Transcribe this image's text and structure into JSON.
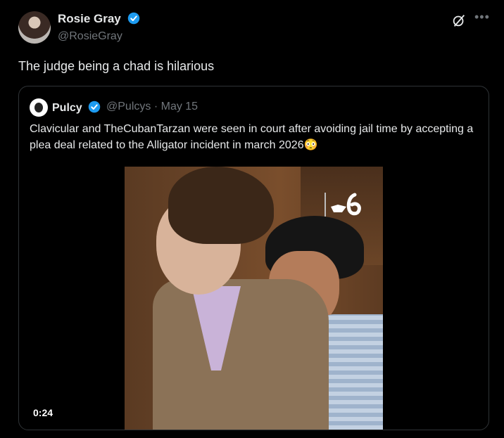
{
  "tweet": {
    "author_name": "Rosie Gray",
    "author_handle": "@RosieGray",
    "text": "The judge being a chad is hilarious"
  },
  "quoted": {
    "author_name": "Pulcy",
    "author_handle": "@Pulcys",
    "separator": "·",
    "date": "May 15",
    "text": "Clavicular and TheCubanTarzan were seen in court after avoiding jail time by accepting a plea deal related to the Alligator incident in march 2026😳",
    "video_time": "0:24"
  },
  "colors": {
    "verified": "#1d9bf0",
    "muted": "#71767b",
    "text": "#e7e9ea"
  },
  "icons": [
    "verified-badge-icon",
    "grok-icon",
    "more-icon",
    "nbc6-logo-icon"
  ]
}
